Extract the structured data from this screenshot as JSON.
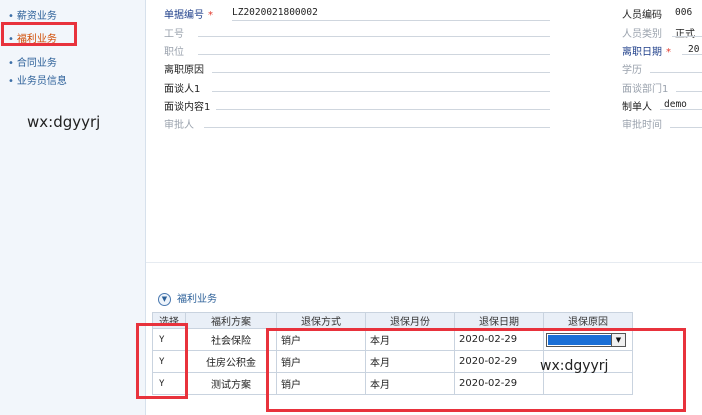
{
  "sidebar": {
    "items": [
      {
        "label": "薪资业务",
        "active": false
      },
      {
        "label": "福利业务",
        "active": true
      },
      {
        "label": "合同业务",
        "active": false
      },
      {
        "label": "业务员信息",
        "active": false
      }
    ]
  },
  "watermark_left": "wx:dgyyrj",
  "watermark_right": "wx:dgyyrj",
  "form": {
    "doc_no_label": "单据编号",
    "doc_no_value": "LZ2020021800002",
    "job_no_label": "工号",
    "position_label": "职位",
    "leave_reason_label": "离职原因",
    "interviewer_label": "面谈人1",
    "interview_content_label": "面谈内容1",
    "approver_label": "审批人",
    "emp_code_label": "人员编码",
    "emp_code_value": "006",
    "emp_type_label": "人员类别",
    "emp_type_value": "正式",
    "leave_date_label": "离职日期",
    "leave_date_value": "20",
    "education_label": "学历",
    "interview_dept_label": "面谈部门1",
    "creator_label": "制单人",
    "creator_value": "demo",
    "approve_time_label": "审批时间"
  },
  "section": {
    "title": "福利业务",
    "icon": "chevron-down-circle-icon"
  },
  "table": {
    "headers": [
      "选择",
      "福利方案",
      "退保方式",
      "退保月份",
      "退保日期",
      "退保原因"
    ],
    "rows": [
      {
        "select": "Y",
        "plan": "社会保险",
        "method": "销户",
        "month": "本月",
        "date": "2020-02-29",
        "reason": ""
      },
      {
        "select": "Y",
        "plan": "住房公积金",
        "method": "销户",
        "month": "本月",
        "date": "2020-02-29",
        "reason": ""
      },
      {
        "select": "Y",
        "plan": "测试方案",
        "method": "销户",
        "month": "本月",
        "date": "2020-02-29",
        "reason": ""
      }
    ]
  },
  "colors": {
    "highlight_box": "#e8323c",
    "link_blue": "#2b5f98",
    "required_star": "#e23a2d",
    "combo_selection": "#1a6fd6"
  }
}
